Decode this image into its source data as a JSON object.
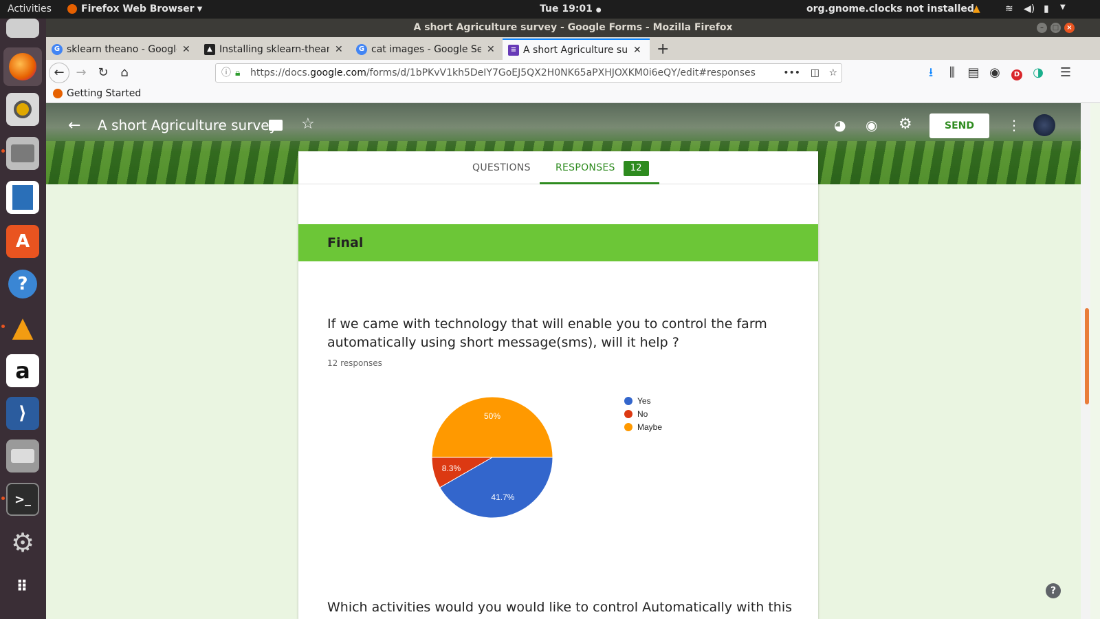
{
  "topbar": {
    "activities": "Activities",
    "app_menu": "Firefox Web Browser",
    "clock": "Tue 19:01",
    "notification": "org.gnome.clocks not installed"
  },
  "window": {
    "title": "A short Agriculture survey - Google Forms - Mozilla Firefox"
  },
  "tabs": [
    {
      "label": "sklearn theano - Google Search",
      "icon": "google-icon"
    },
    {
      "label": "Installing sklearn-theano",
      "icon": "page-icon"
    },
    {
      "label": "cat images - Google Search",
      "icon": "google-icon"
    },
    {
      "label": "A short Agriculture survey",
      "icon": "forms-icon",
      "active": true
    }
  ],
  "url": {
    "prefix": "https://docs.",
    "domain": "google.com",
    "path": "/forms/d/1bPKvV1kh5DeIY7GoEJ5QX2H0NK65aPXHJOXKM0i6eQY/edit#responses"
  },
  "bookmarks": {
    "getting_started": "Getting Started"
  },
  "form": {
    "title": "A short Agriculture survey",
    "send_label": "SEND",
    "tab_questions": "QUESTIONS",
    "tab_responses": "RESPONSES",
    "responses_count": "12",
    "section_title": "Final",
    "question": "If we came with technology that will enable you to control the farm automatically using short message(sms), will it help ?",
    "responses_text": "12 responses",
    "next_question": "Which activities would you would like to control Automatically with this"
  },
  "colors": {
    "brand_green": "#2e8b1f",
    "section_green": "#6cc637",
    "yes": "#3366cc",
    "no": "#dc3912",
    "maybe": "#ff9900"
  },
  "chart_data": {
    "type": "pie",
    "categories": [
      "Yes",
      "No",
      "Maybe"
    ],
    "values": [
      41.7,
      8.3,
      50
    ],
    "labels": [
      "41.7%",
      "8.3%",
      "50%"
    ],
    "colors": [
      "#3366cc",
      "#dc3912",
      "#ff9900"
    ],
    "legend_position": "right"
  }
}
